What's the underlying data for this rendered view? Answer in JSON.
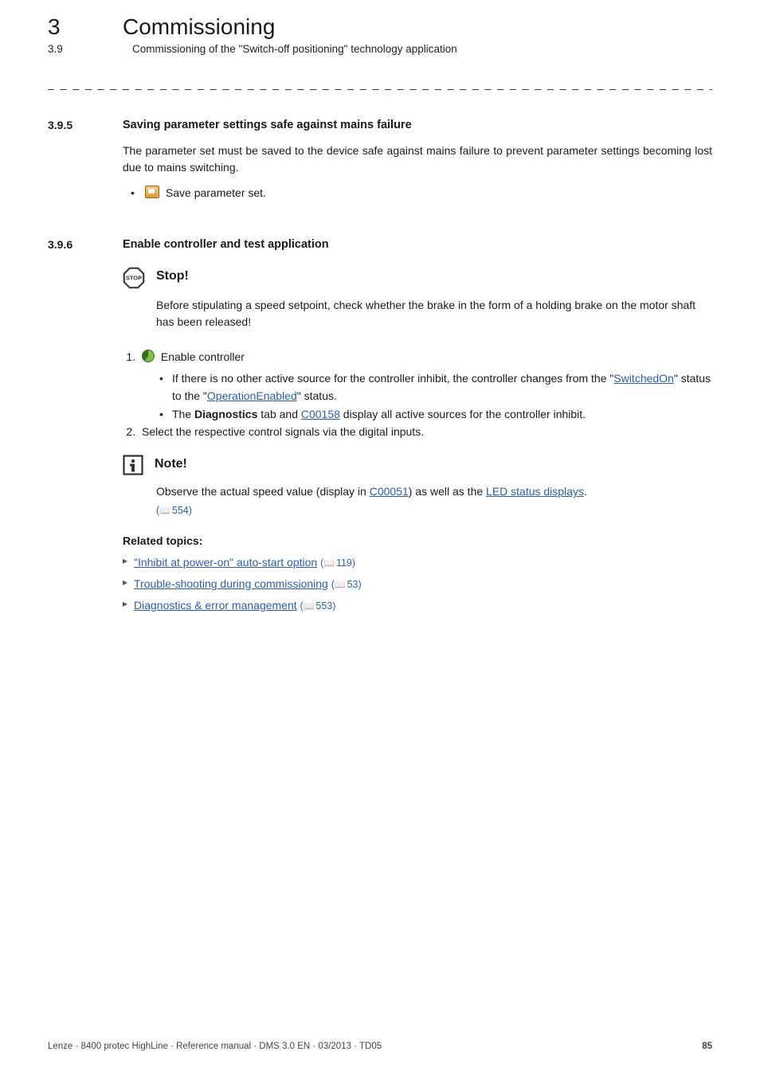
{
  "chapter": {
    "num": "3",
    "title": "Commissioning"
  },
  "subchapter": {
    "num": "3.9",
    "title": "Commissioning of the \"Switch-off positioning\" technology application"
  },
  "dashes": "_ _ _ _ _ _ _ _ _ _ _ _ _ _ _ _ _ _ _ _ _ _ _ _ _ _ _ _ _ _ _ _ _ _ _ _ _ _ _ _ _ _ _ _ _ _ _ _ _ _ _ _ _ _ _ _ _ _ _ _ _ _ _ _",
  "s395": {
    "num": "3.9.5",
    "title": "Saving parameter settings safe against mains failure",
    "para": "The parameter set must be saved to the device safe against mains failure to prevent parameter settings becoming lost due to mains switching.",
    "bullet": "Save parameter set."
  },
  "s396": {
    "num": "3.9.6",
    "title": "Enable controller and test application",
    "stop": {
      "title": "Stop!",
      "body": "Before stipulating a speed setpoint, check whether the brake in the form of a holding brake on the motor shaft has been released!"
    },
    "step1": {
      "label": "Enable controller",
      "sub_a_pre": "If there is no other active source for the controller inhibit, the controller changes from the \"",
      "sub_a_link1": "SwitchedOn",
      "sub_a_mid": "\" status to the \"",
      "sub_a_link2": "OperationEnabled",
      "sub_a_post": "\" status.",
      "sub_b_pre": "The ",
      "sub_b_strong": "Diagnostics",
      "sub_b_mid": " tab and ",
      "sub_b_link": "C00158",
      "sub_b_post": " display all active sources for the controller inhibit."
    },
    "step2": "Select the respective control signals via the digital inputs.",
    "note": {
      "title": "Note!",
      "body_pre": "Observe the actual speed value (display in ",
      "body_link1": "C00051",
      "body_mid": ") as well as the ",
      "body_link2": "LED status displays",
      "body_post": ".",
      "pageref": "554"
    },
    "related_title": "Related topics:",
    "related": [
      {
        "text": "\"Inhibit at power-on\" auto-start option",
        "page": "119"
      },
      {
        "text": "Trouble-shooting during commissioning",
        "page": "53"
      },
      {
        "text": "Diagnostics & error management",
        "page": "553"
      }
    ]
  },
  "footer": {
    "left": "Lenze · 8400 protec HighLine · Reference manual · DMS 3.0 EN · 03/2013 · TD05",
    "right": "85"
  }
}
